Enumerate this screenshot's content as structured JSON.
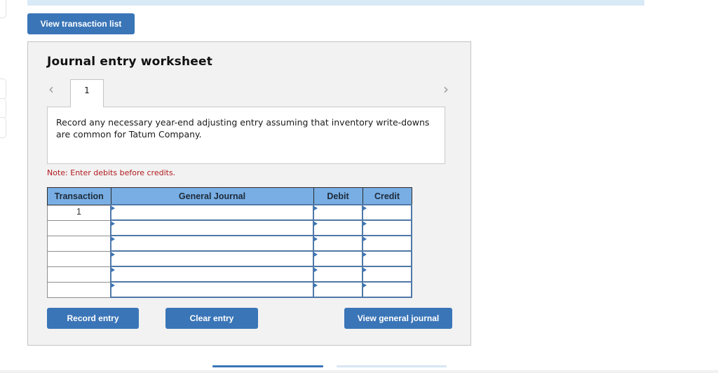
{
  "toolbar": {
    "view_transaction_list_label": "View transaction list"
  },
  "worksheet": {
    "title": "Journal entry worksheet",
    "nav": {
      "prev_icon": "chevron-left-icon",
      "next_icon": "chevron-right-icon",
      "prev_glyph": "‹",
      "next_glyph": "›"
    },
    "tabs": [
      {
        "label": "1",
        "active": true
      }
    ],
    "prompt": "Record any necessary year-end adjusting entry assuming that inventory write-downs are common for Tatum Company.",
    "note": "Note: Enter debits before credits.",
    "table": {
      "columns": [
        "Transaction",
        "General Journal",
        "Debit",
        "Credit"
      ],
      "rows": [
        {
          "transaction": "1",
          "account": "",
          "debit": "",
          "credit": ""
        },
        {
          "transaction": "",
          "account": "",
          "debit": "",
          "credit": ""
        },
        {
          "transaction": "",
          "account": "",
          "debit": "",
          "credit": ""
        },
        {
          "transaction": "",
          "account": "",
          "debit": "",
          "credit": ""
        },
        {
          "transaction": "",
          "account": "",
          "debit": "",
          "credit": ""
        },
        {
          "transaction": "",
          "account": "",
          "debit": "",
          "credit": ""
        }
      ]
    },
    "buttons": {
      "record_entry": "Record entry",
      "clear_entry": "Clear entry",
      "view_general_journal": "View general journal"
    }
  },
  "colors": {
    "button_blue": "#3a75b7",
    "header_blue": "#78aee3",
    "note_red": "#b0191e",
    "panel_bg": "#f2f2f2",
    "banner": "#d9eaf7"
  }
}
